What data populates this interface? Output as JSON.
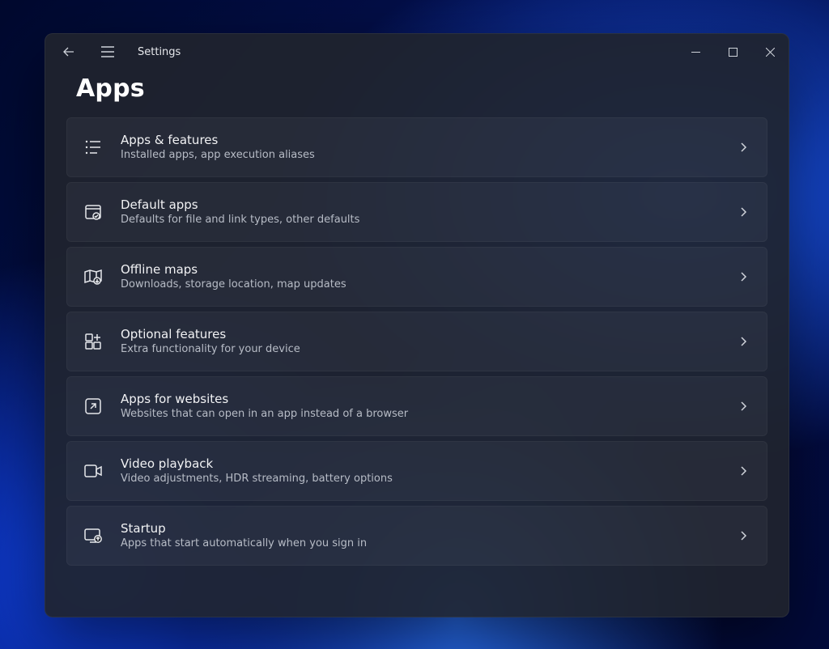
{
  "app_title": "Settings",
  "page_title": "Apps",
  "items": [
    {
      "title": "Apps & features",
      "sub": "Installed apps, app execution aliases",
      "icon": "apps-features-icon"
    },
    {
      "title": "Default apps",
      "sub": "Defaults for file and link types, other defaults",
      "icon": "default-apps-icon"
    },
    {
      "title": "Offline maps",
      "sub": "Downloads, storage location, map updates",
      "icon": "offline-maps-icon"
    },
    {
      "title": "Optional features",
      "sub": "Extra functionality for your device",
      "icon": "optional-features-icon"
    },
    {
      "title": "Apps for websites",
      "sub": "Websites that can open in an app instead of a browser",
      "icon": "apps-websites-icon"
    },
    {
      "title": "Video playback",
      "sub": "Video adjustments, HDR streaming, battery options",
      "icon": "video-playback-icon"
    },
    {
      "title": "Startup",
      "sub": "Apps that start automatically when you sign in",
      "icon": "startup-icon"
    }
  ]
}
